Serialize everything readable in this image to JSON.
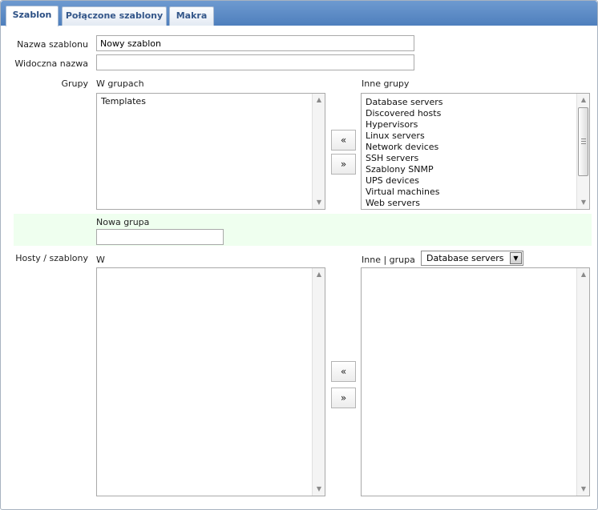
{
  "tabs": [
    {
      "label": "Szablon"
    },
    {
      "label": "Połączone szablony"
    },
    {
      "label": "Makra"
    }
  ],
  "form": {
    "template_name_label": "Nazwa szablonu",
    "template_name_value": "Nowy szablon",
    "visible_name_label": "Widoczna nazwa",
    "visible_name_value": "",
    "groups_label": "Grupy",
    "in_groups_caption": "W grupach",
    "other_groups_caption": "Inne grupy",
    "in_groups": [
      "Templates"
    ],
    "other_groups": [
      "Database servers",
      "Discovered hosts",
      "Hypervisors",
      "Linux servers",
      "Network devices",
      "SSH servers",
      "Szablony SNMP",
      "UPS devices",
      "Virtual machines",
      "Web servers"
    ],
    "new_group_label": "Nowa grupa",
    "new_group_value": "",
    "hosts_label": "Hosty / szablony",
    "in_caption": "W",
    "other_group_caption": "Inne | grupa",
    "group_select_value": "Database servers",
    "move_left": "«",
    "move_right": "»"
  },
  "icons": {
    "scroll_up": "▲",
    "scroll_down": "▼",
    "dropdown": "▼"
  }
}
